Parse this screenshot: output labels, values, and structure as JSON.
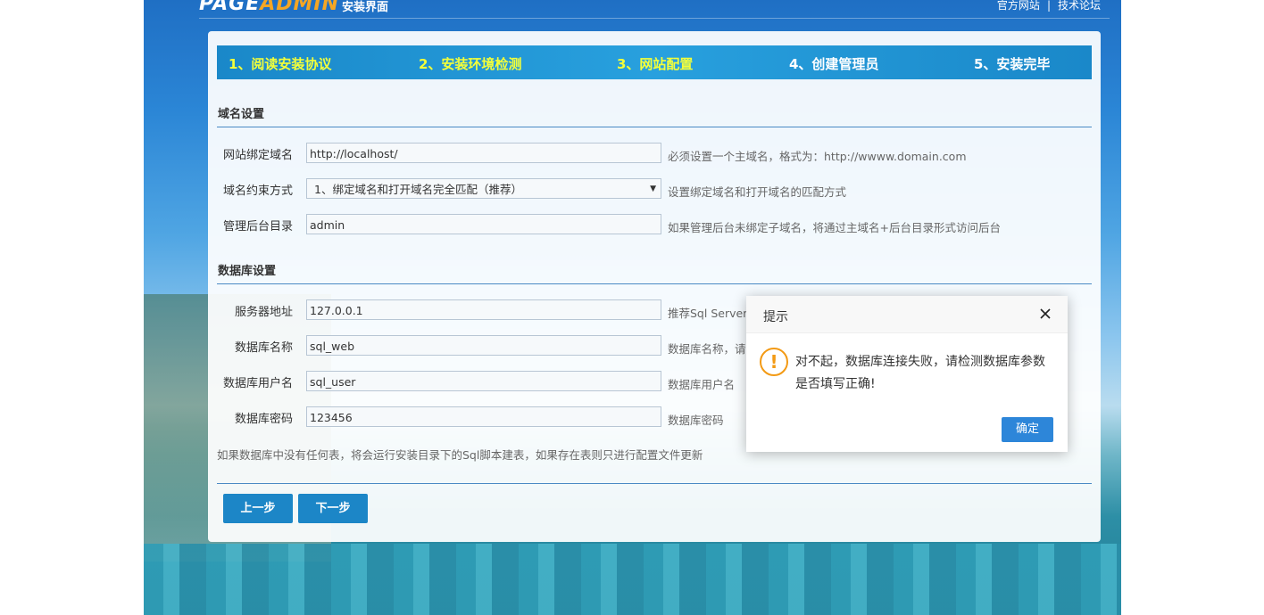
{
  "header": {
    "logo_page": "PAGE",
    "logo_admin": "ADMIN",
    "subtitle": "安装界面",
    "links": [
      "官方网站",
      "技术论坛"
    ],
    "link_separator": "|"
  },
  "steps": [
    {
      "label": "1、阅读安装协议",
      "state": "done"
    },
    {
      "label": "2、安装环境检测",
      "state": "done"
    },
    {
      "label": "3、网站配置",
      "state": "current"
    },
    {
      "label": "4、创建管理员",
      "state": "todo"
    },
    {
      "label": "5、安装完毕",
      "state": "todo"
    }
  ],
  "domain_section": {
    "title": "域名设置",
    "bind_domain": {
      "label": "网站绑定域名",
      "value": "http://localhost/",
      "hint": "必须设置一个主域名，格式为：http://wwww.domain.com"
    },
    "constraint": {
      "label": "域名约束方式",
      "value": "1、绑定域名和打开域名完全匹配（推荐）",
      "hint": "设置绑定域名和打开域名的匹配方式"
    },
    "admin_dir": {
      "label": "管理后台目录",
      "value": "admin",
      "hint": "如果管理后台未绑定子域名，将通过主域名+后台目录形式访问后台"
    }
  },
  "db_section": {
    "title": "数据库设置",
    "server": {
      "label": "服务器地址",
      "value": "127.0.0.1",
      "hint": "推荐Sql Server2"
    },
    "db_name": {
      "label": "数据库名称",
      "value": "sql_web",
      "hint": "数据库名称，请"
    },
    "db_user": {
      "label": "数据库用户名",
      "value": "sql_user",
      "hint": "数据库用户名"
    },
    "db_pass": {
      "label": "数据库密码",
      "value": "123456",
      "hint": "数据库密码"
    },
    "note": "如果数据库中没有任何表，将会运行安装目录下的Sql脚本建表，如果存在表则只进行配置文件更新"
  },
  "buttons": {
    "prev": "上一步",
    "next": "下一步"
  },
  "dialog": {
    "title": "提示",
    "icon": "!",
    "message": "对不起，数据库连接失败，请检测数据库参数是否填写正确!",
    "ok": "确定"
  },
  "colors": {
    "step_done": "#f3ff3a",
    "step_todo": "#ffffff",
    "accent": "#1c86c7",
    "dialog_button": "#2d86d9",
    "warning": "#f39a14"
  }
}
